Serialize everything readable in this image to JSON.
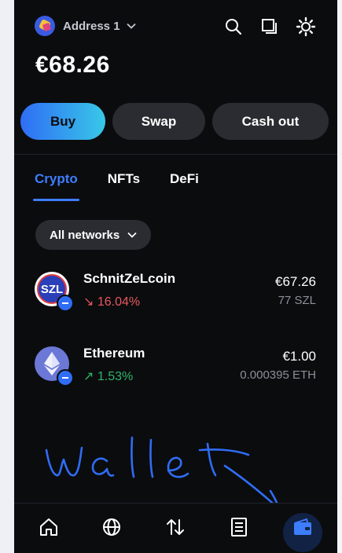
{
  "header": {
    "address_label": "Address 1",
    "icons": [
      "search-icon",
      "copy-icon",
      "settings-icon"
    ]
  },
  "balance": "€68.26",
  "actions": {
    "buy": "Buy",
    "swap": "Swap",
    "cash_out": "Cash out"
  },
  "tabs": [
    {
      "label": "Crypto",
      "active": true
    },
    {
      "label": "NFTs",
      "active": false
    },
    {
      "label": "DeFi",
      "active": false
    }
  ],
  "filter": {
    "label": "All networks"
  },
  "assets": [
    {
      "icon_text": "SZL",
      "name": "SchnitZeLcoin",
      "change": "↘ 16.04%",
      "direction": "down",
      "value": "€67.26",
      "amount": "77 SZL"
    },
    {
      "icon_text": "",
      "name": "Ethereum",
      "change": "↗ 1.53%",
      "direction": "up",
      "value": "€1.00",
      "amount": "0.000395 ETH"
    }
  ],
  "annotation": {
    "text": "wallet",
    "color": "#2f6df5"
  },
  "bottom_nav": [
    {
      "icon": "home-icon",
      "active": false
    },
    {
      "icon": "globe-icon",
      "active": false
    },
    {
      "icon": "transfer-icon",
      "active": false
    },
    {
      "icon": "activity-list-icon",
      "active": false
    },
    {
      "icon": "wallet-icon",
      "active": true
    }
  ],
  "colors": {
    "accent": "#3d7dff",
    "background": "#0b0c0e",
    "negative": "#e8585f",
    "positive": "#2fb56a"
  }
}
